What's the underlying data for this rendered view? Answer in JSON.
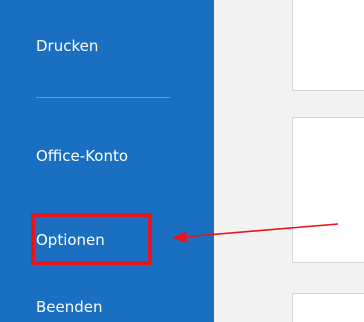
{
  "sidebar": {
    "items": [
      {
        "label": "Drucken"
      },
      {
        "label": "Office-Konto"
      },
      {
        "label": "Optionen"
      },
      {
        "label": "Beenden"
      }
    ]
  },
  "colors": {
    "sidebar_bg": "#1a6fc1",
    "highlight": "#e8141b",
    "arrow": "#e8141b"
  }
}
